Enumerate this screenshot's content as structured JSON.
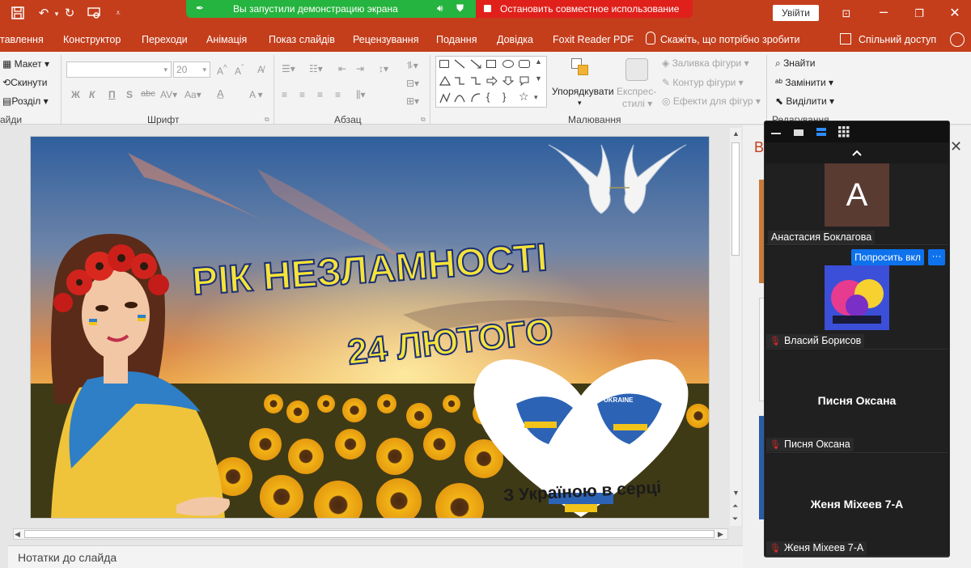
{
  "titlebar": {
    "sharing_status": "Вы запустили демонстрацию экрана",
    "stop_sharing": "Остановить совместное использование",
    "sign_out": "Увійти"
  },
  "tabs": [
    "тавлення",
    "Конструктор",
    "Переходи",
    "Анімація",
    "Показ слайдів",
    "Рецензування",
    "Подання",
    "Довідка",
    "Foxit Reader PDF"
  ],
  "tell_me": "Скажіть, що потрібно зробити",
  "share": "Спільний доступ",
  "ribbon": {
    "slides": {
      "layout": "Макет",
      "reset": "Скинути",
      "section": "Розділ",
      "label": "айди"
    },
    "font": {
      "size": "20",
      "label": "Шрифт",
      "bold": "Ж",
      "italic": "К",
      "underline": "П",
      "shadow": "S",
      "strike": "abc",
      "case": "Aa"
    },
    "paragraph": {
      "label": "Абзац"
    },
    "drawing": {
      "arrange": "Упорядкувати",
      "quick_styles_1": "Експрес-",
      "quick_styles_2": "стилі",
      "fill": "Заливка фігури",
      "outline": "Контур фігури",
      "effects": "Ефекти для фігур",
      "label": "Малювання"
    },
    "editing": {
      "find": "Знайти",
      "replace": "Замінити",
      "select": "Виділити",
      "label": "Редагування"
    }
  },
  "slide": {
    "title_line1": "РІК НЕЗЛАМНОСТІ",
    "title_line2": "24 ЛЮТОГО",
    "heart_text": "З Україною в серці",
    "heart_small": "UKRAINE"
  },
  "notes": "Нотатки до слайда",
  "zoom": {
    "participants": [
      {
        "initial": "А",
        "name": "Анастасия Боклагова"
      },
      {
        "name": "Власий Борисов"
      },
      {
        "big_name": "Писня Оксана",
        "name": "Писня Оксана"
      },
      {
        "big_name": "Женя Міхеев 7-А",
        "name": "Женя Міхеев 7-А"
      }
    ],
    "ask_unmute": "Попросить вкл",
    "more": "···"
  },
  "colors": {
    "accent": "#c43e1c",
    "green": "#25b43f",
    "red": "#e0201b",
    "zoom_blue": "#0e72ed"
  }
}
